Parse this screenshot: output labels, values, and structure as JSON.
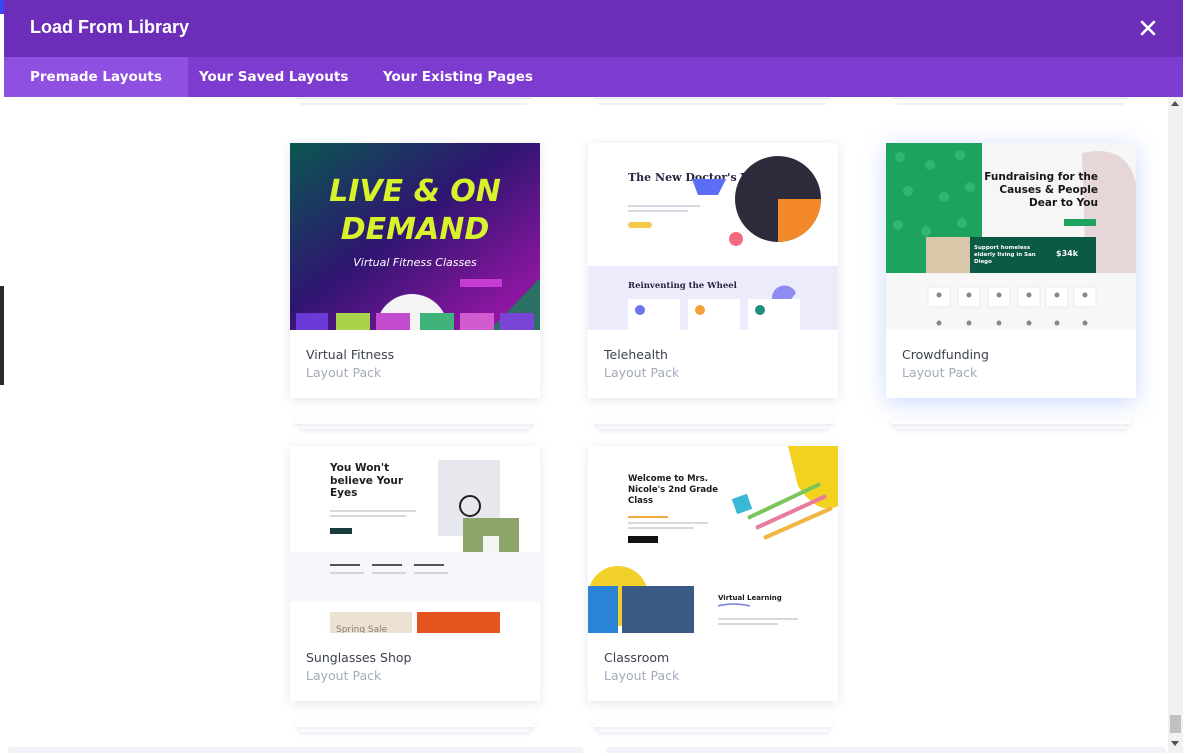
{
  "header": {
    "title": "Load From Library"
  },
  "tabs": [
    {
      "label": "Premade Layouts",
      "active": true
    },
    {
      "label": "Your Saved Layouts",
      "active": false
    },
    {
      "label": "Your Existing Pages",
      "active": false
    }
  ],
  "cards": [
    {
      "title": "Virtual Fitness",
      "subtitle": "Layout Pack",
      "thumb": {
        "headline_1": "LIVE & ON",
        "headline_2": "DEMAND",
        "tagline": "Virtual Fitness Classes"
      }
    },
    {
      "title": "Telehealth",
      "subtitle": "Layout Pack",
      "thumb": {
        "headline": "The New Doctor's Visit",
        "section": "Reinventing the Wheel"
      }
    },
    {
      "title": "Crowdfunding",
      "subtitle": "Layout Pack",
      "highlighted": true,
      "thumb": {
        "headline": "Fundraising for the Causes & People Dear to You",
        "banner": "Support homeless elderly living in San Diego",
        "amount": "$34k"
      }
    },
    {
      "title": "Sunglasses Shop",
      "subtitle": "Layout Pack",
      "thumb": {
        "headline": "You Won't believe Your Eyes",
        "promo": "Spring Sale"
      }
    },
    {
      "title": "Classroom",
      "subtitle": "Layout Pack",
      "thumb": {
        "headline": "Welcome to Mrs. Nicole's 2nd Grade Class",
        "section": "Virtual Learning"
      }
    }
  ],
  "colors": {
    "header_bg": "#6c2eb9",
    "tabs_bg": "#7e3bd0",
    "active_tab_bg": "#8f4fe0",
    "card_title": "#3b4150",
    "card_subtitle": "#a3aabb"
  },
  "icons": {
    "close": "close-icon"
  }
}
